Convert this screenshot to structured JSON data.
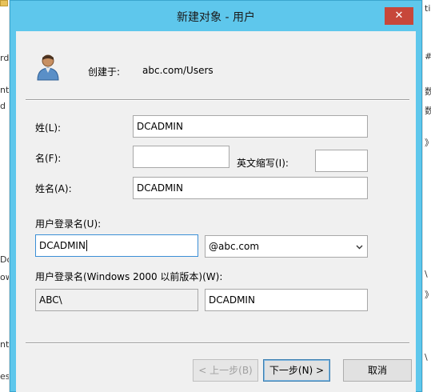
{
  "dialog": {
    "title": "新建对象 - 用户",
    "close_glyph": "✕",
    "created_in_label": "创建于:",
    "created_in_path": "abc.com/Users"
  },
  "form": {
    "last_name_label": "姓(L):",
    "last_name_value": "DCADMIN",
    "first_name_label": "名(F):",
    "first_name_value": "",
    "initials_label": "英文缩写(I):",
    "initials_value": "",
    "full_name_label": "姓名(A):",
    "full_name_value": "DCADMIN",
    "logon_name_label": "用户登录名(U):",
    "logon_name_value": "DCADMIN",
    "upn_suffix_value": "@abc.com",
    "pre2000_label": "用户登录名(Windows 2000 以前版本)(W):",
    "pre2000_domain_value": "ABC\\",
    "pre2000_name_value": "DCADMIN"
  },
  "buttons": {
    "back_label": "< 上一步(B)",
    "next_label": "下一步(N) >",
    "cancel_label": "取消"
  },
  "background": {
    "left_fragments": [
      "rd",
      "ntr",
      "d",
      "Do",
      "ow",
      "ntr",
      "es"
    ],
    "right_fragments": [
      "ti",
      "#",
      "数",
      "数",
      "》",
      "\\",
      "》",
      "\\"
    ]
  },
  "colors": {
    "title_bar": "#5ec7ec",
    "close_button": "#c7473a",
    "focus_border": "#3b8fd6"
  },
  "icons": {
    "user": "user-icon",
    "dropdown": "chevron-down-icon",
    "close": "close-icon"
  }
}
